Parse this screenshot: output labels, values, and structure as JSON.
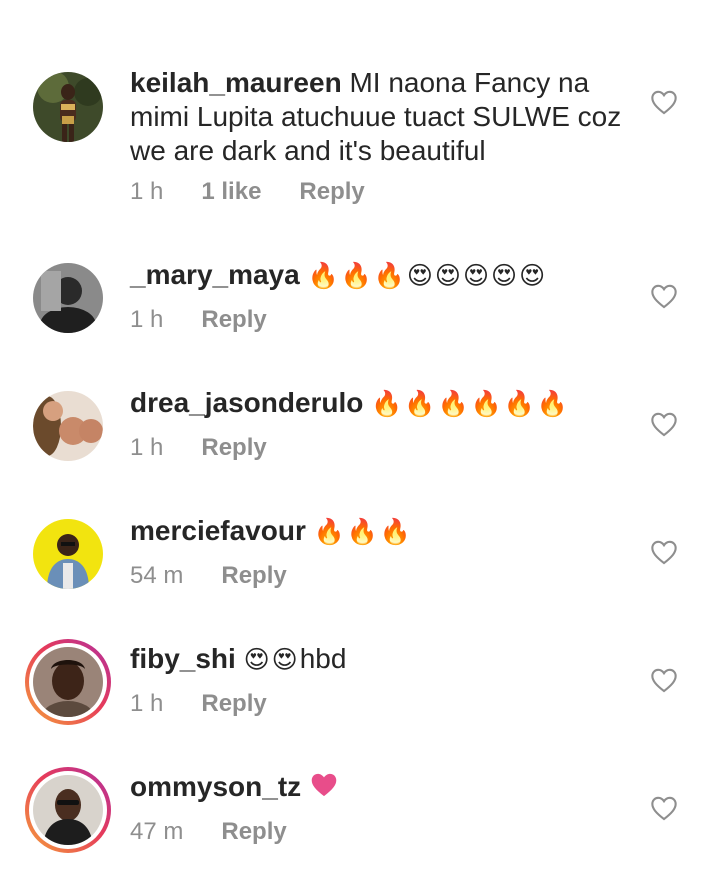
{
  "comments": [
    {
      "username": "keilah_maureen",
      "text": "MI naona Fancy na mimi Lupita atuchuue tuact SULWE coz we are dark and it's beautiful",
      "emoji": "",
      "time": "1 h",
      "likes": "1 like",
      "reply": "Reply",
      "avatar_icon": "user-avatar",
      "story_ring": false
    },
    {
      "username": "_mary_maya",
      "text": "",
      "emoji": "🔥🔥🔥😍😍😍😍😍",
      "time": "1 h",
      "likes": "",
      "reply": "Reply",
      "avatar_icon": "user-avatar",
      "story_ring": false
    },
    {
      "username": "drea_jasonderulo",
      "text": "",
      "emoji": "🔥🔥🔥🔥🔥🔥",
      "time": "1 h",
      "likes": "",
      "reply": "Reply",
      "avatar_icon": "user-avatar",
      "story_ring": false
    },
    {
      "username": "merciefavour",
      "text": "",
      "emoji": "🔥🔥🔥",
      "time": "54 m",
      "likes": "",
      "reply": "Reply",
      "avatar_icon": "user-avatar",
      "story_ring": false
    },
    {
      "username": "fiby_shi",
      "text": "hbd",
      "emoji": "😍😍",
      "time": "1 h",
      "likes": "",
      "reply": "Reply",
      "avatar_icon": "user-avatar",
      "story_ring": true
    },
    {
      "username": "ommyson_tz",
      "text": "",
      "emoji": "pink-heart",
      "time": "47 m",
      "likes": "",
      "reply": "Reply",
      "avatar_icon": "user-avatar",
      "story_ring": true
    }
  ],
  "colors": {
    "text": "#262626",
    "meta": "#8e8e8e",
    "heart_outline": "#8e8e8e",
    "pink_heart": "#e84d8a"
  }
}
